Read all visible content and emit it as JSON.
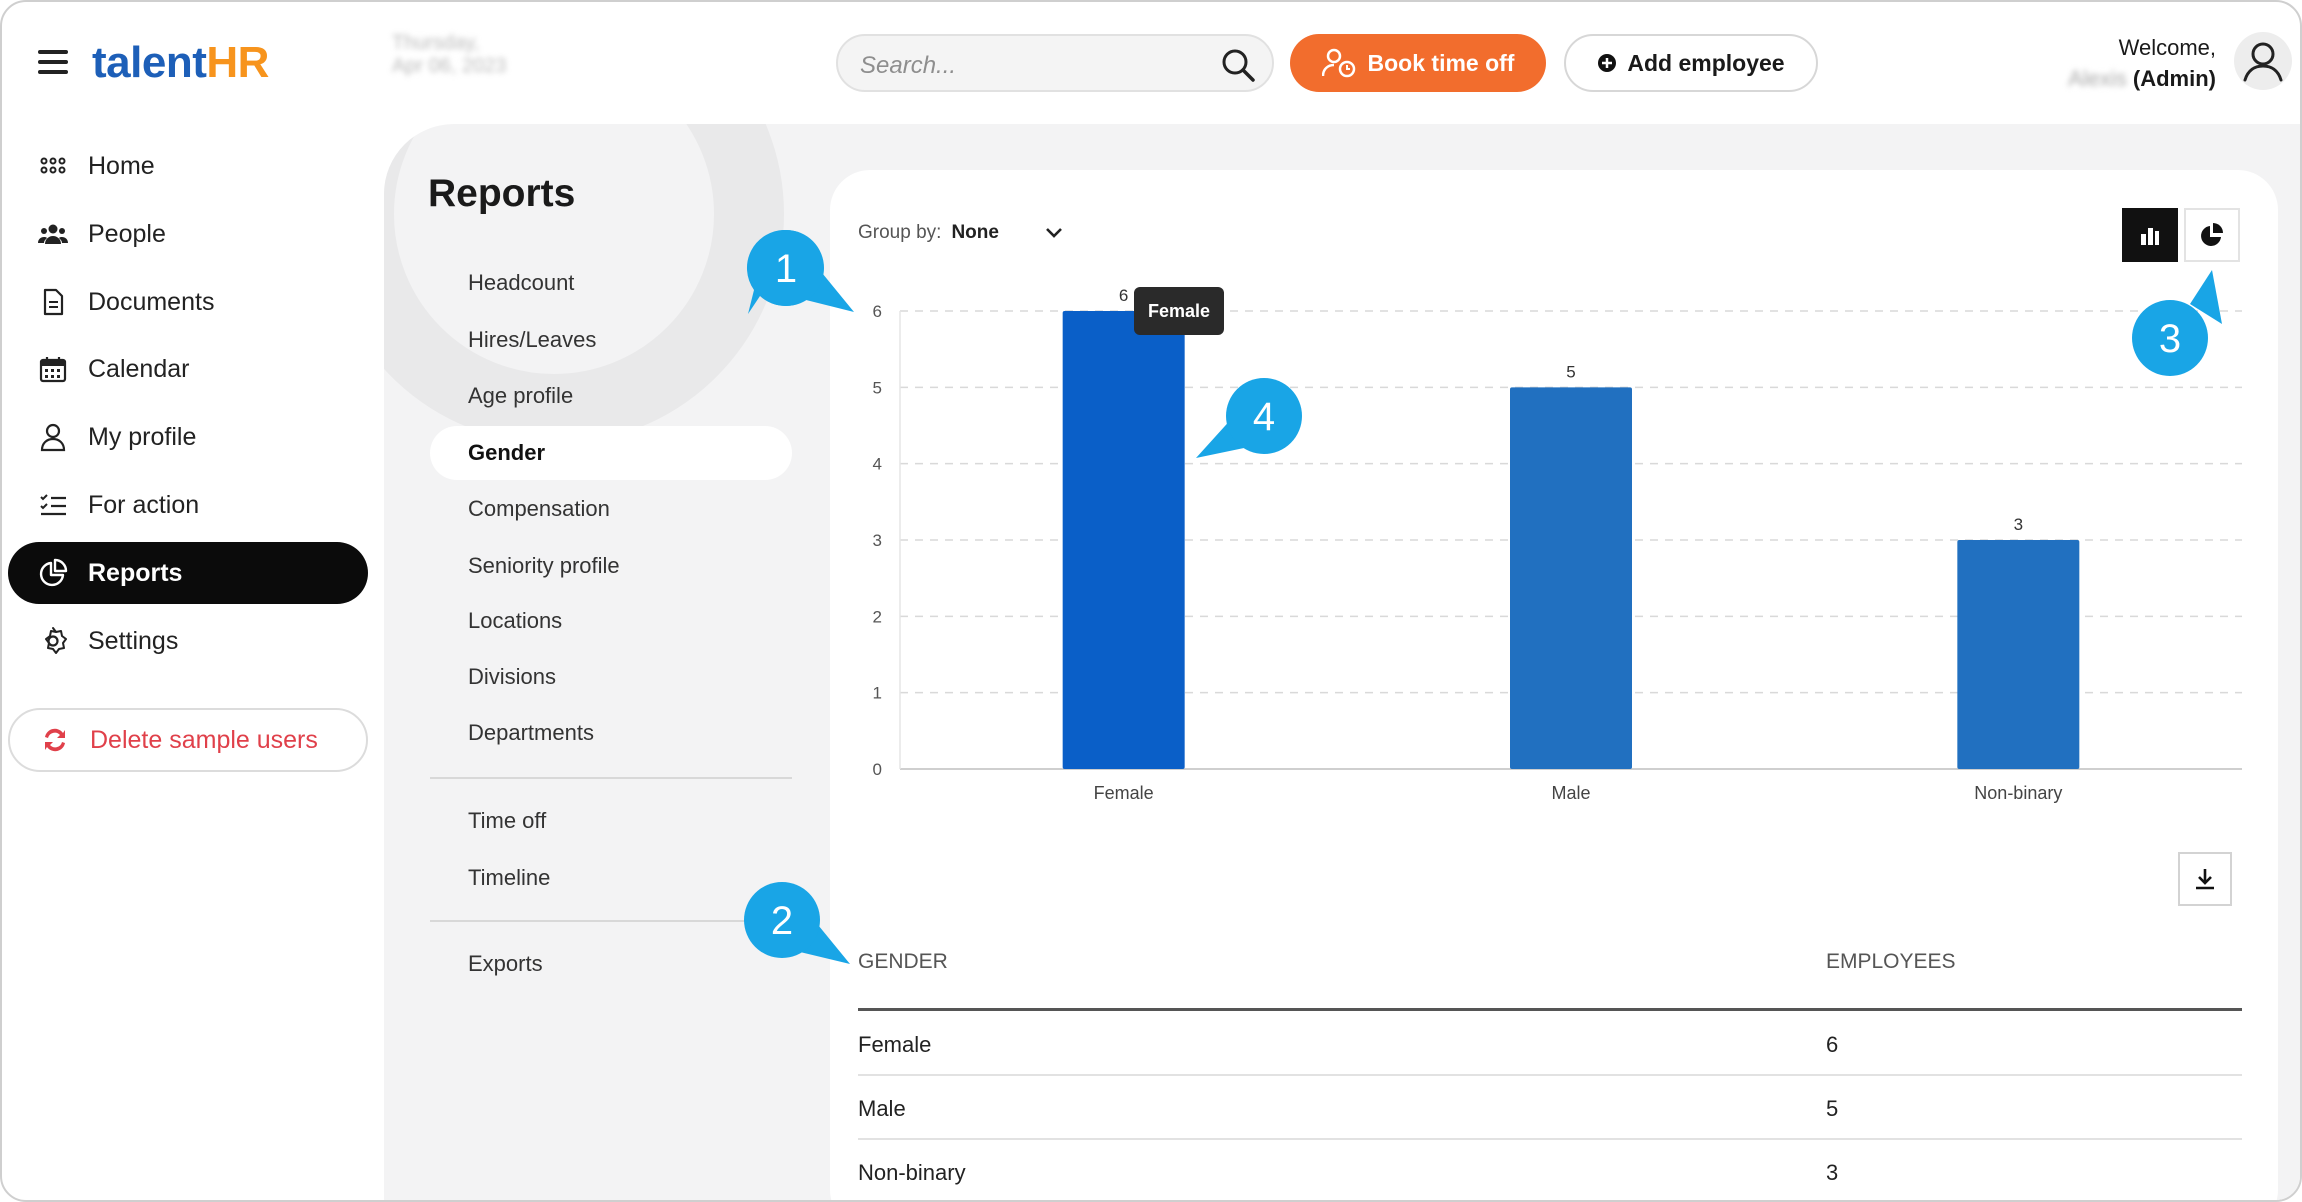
{
  "header": {
    "logo_main": "talent",
    "logo_accent": "HR",
    "date_line1": "Thursday,",
    "date_line2": "Apr 06, 2023",
    "search_placeholder": "Search...",
    "book_time_off": "Book time off",
    "add_employee": "Add employee",
    "welcome": "Welcome,",
    "user_name": "Alexis",
    "user_role": "(Admin)"
  },
  "sidebar": {
    "items": [
      {
        "label": "Home",
        "icon": "grid-icon"
      },
      {
        "label": "People",
        "icon": "people-icon"
      },
      {
        "label": "Documents",
        "icon": "document-icon"
      },
      {
        "label": "Calendar",
        "icon": "calendar-icon"
      },
      {
        "label": "My profile",
        "icon": "user-icon"
      },
      {
        "label": "For action",
        "icon": "checklist-icon"
      },
      {
        "label": "Reports",
        "icon": "pie-chart-icon",
        "active": true
      },
      {
        "label": "Settings",
        "icon": "gear-icon"
      }
    ],
    "delete_sample": "Delete sample users"
  },
  "reports": {
    "title": "Reports",
    "menu": [
      "Headcount",
      "Hires/Leaves",
      "Age profile",
      "Gender",
      "Compensation",
      "Seniority profile",
      "Locations",
      "Divisions",
      "Departments"
    ],
    "menu2": [
      "Time off",
      "Timeline"
    ],
    "menu3": [
      "Exports"
    ],
    "active": "Gender"
  },
  "card": {
    "group_by_label": "Group by:",
    "group_by_value": "None",
    "tooltip": "Female",
    "table": {
      "headers": [
        "GENDER",
        "EMPLOYEES"
      ],
      "rows": [
        [
          "Female",
          "6"
        ],
        [
          "Male",
          "5"
        ],
        [
          "Non-binary",
          "3"
        ]
      ]
    }
  },
  "chart_data": {
    "type": "bar",
    "categories": [
      "Female",
      "Male",
      "Non-binary"
    ],
    "values": [
      6,
      5,
      3
    ],
    "ylim": [
      0,
      6
    ],
    "yticks": [
      0,
      1,
      2,
      3,
      4,
      5,
      6
    ],
    "grid": true,
    "highlighted": "Female",
    "colors": {
      "bar": "#2170c0",
      "highlight": "#0a5fc8"
    }
  },
  "callouts": [
    "1",
    "2",
    "3",
    "4"
  ],
  "colors": {
    "accent_orange": "#f26d2d",
    "brand_blue": "#1d5fb8",
    "callout_blue": "#19a5e6"
  }
}
